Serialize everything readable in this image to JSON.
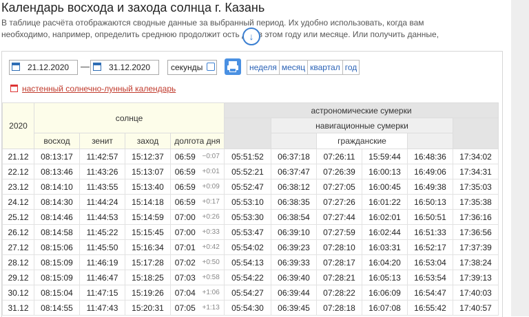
{
  "page": {
    "title": "Календарь восхода и захода солнца г. Казань",
    "intro_line1": "В таблице расчёта отображаются сводные данные за выбранный период. Их удобно использовать, когда вам",
    "intro_line2": "необходимо, например, определить среднюю продолжит      ость дня в этом году или месяце. Или получить данные,"
  },
  "controls": {
    "date_from": "21.12.2020",
    "dash": "—",
    "date_to": "31.12.2020",
    "seconds_label": "секунды",
    "seconds_checked": false,
    "periods": [
      "неделя",
      "месяц",
      "квартал",
      "год"
    ],
    "wall_calendar_link": "настенный солнечно-лунный календарь"
  },
  "table": {
    "year": "2020",
    "group_sun": "солнце",
    "group_astro": "астрономические сумерки",
    "group_nav": "навигационные сумерки",
    "group_civil": "гражданские",
    "col_sunrise": "восход",
    "col_zenith": "зенит",
    "col_sunset": "заход",
    "col_daylength": "долгота дня",
    "rows": [
      {
        "d": "21.12",
        "rise": "08:13:17",
        "zen": "11:42:57",
        "set": "15:12:37",
        "len": "06:59",
        "delta": "−0:07",
        "a1": "05:51:52",
        "n1": "06:37:18",
        "c1": "07:26:11",
        "c2": "15:59:44",
        "n2": "16:48:36",
        "a2": "17:34:02"
      },
      {
        "d": "22.12",
        "rise": "08:13:46",
        "zen": "11:43:26",
        "set": "15:13:07",
        "len": "06:59",
        "delta": "+0:01",
        "a1": "05:52:21",
        "n1": "06:37:47",
        "c1": "07:26:39",
        "c2": "16:00:13",
        "n2": "16:49:06",
        "a2": "17:34:31"
      },
      {
        "d": "23.12",
        "rise": "08:14:10",
        "zen": "11:43:55",
        "set": "15:13:40",
        "len": "06:59",
        "delta": "+0:09",
        "a1": "05:52:47",
        "n1": "06:38:12",
        "c1": "07:27:05",
        "c2": "16:00:45",
        "n2": "16:49:38",
        "a2": "17:35:03"
      },
      {
        "d": "24.12",
        "rise": "08:14:30",
        "zen": "11:44:24",
        "set": "15:14:18",
        "len": "06:59",
        "delta": "+0:17",
        "a1": "05:53:10",
        "n1": "06:38:35",
        "c1": "07:27:26",
        "c2": "16:01:22",
        "n2": "16:50:13",
        "a2": "17:35:38"
      },
      {
        "d": "25.12",
        "rise": "08:14:46",
        "zen": "11:44:53",
        "set": "15:14:59",
        "len": "07:00",
        "delta": "+0:26",
        "a1": "05:53:30",
        "n1": "06:38:54",
        "c1": "07:27:44",
        "c2": "16:02:01",
        "n2": "16:50:51",
        "a2": "17:36:16"
      },
      {
        "d": "26.12",
        "rise": "08:14:58",
        "zen": "11:45:22",
        "set": "15:15:45",
        "len": "07:00",
        "delta": "+0:33",
        "a1": "05:53:47",
        "n1": "06:39:10",
        "c1": "07:27:59",
        "c2": "16:02:44",
        "n2": "16:51:33",
        "a2": "17:36:56"
      },
      {
        "d": "27.12",
        "rise": "08:15:06",
        "zen": "11:45:50",
        "set": "15:16:34",
        "len": "07:01",
        "delta": "+0:42",
        "a1": "05:54:02",
        "n1": "06:39:23",
        "c1": "07:28:10",
        "c2": "16:03:31",
        "n2": "16:52:17",
        "a2": "17:37:39"
      },
      {
        "d": "28.12",
        "rise": "08:15:09",
        "zen": "11:46:19",
        "set": "15:17:28",
        "len": "07:02",
        "delta": "+0:50",
        "a1": "05:54:13",
        "n1": "06:39:33",
        "c1": "07:28:17",
        "c2": "16:04:20",
        "n2": "16:53:04",
        "a2": "17:38:24"
      },
      {
        "d": "29.12",
        "rise": "08:15:09",
        "zen": "11:46:47",
        "set": "15:18:25",
        "len": "07:03",
        "delta": "+0:58",
        "a1": "05:54:22",
        "n1": "06:39:40",
        "c1": "07:28:21",
        "c2": "16:05:13",
        "n2": "16:53:54",
        "a2": "17:39:13"
      },
      {
        "d": "30.12",
        "rise": "08:15:04",
        "zen": "11:47:15",
        "set": "15:19:26",
        "len": "07:04",
        "delta": "+1:06",
        "a1": "05:54:27",
        "n1": "06:39:44",
        "c1": "07:28:22",
        "c2": "16:06:09",
        "n2": "16:54:47",
        "a2": "17:40:03"
      },
      {
        "d": "31.12",
        "rise": "08:14:55",
        "zen": "11:47:43",
        "set": "15:20:31",
        "len": "07:05",
        "delta": "+1:13",
        "a1": "05:54:30",
        "n1": "06:39:45",
        "c1": "07:28:18",
        "c2": "16:07:08",
        "n2": "16:55:42",
        "a2": "17:40:57"
      }
    ]
  }
}
